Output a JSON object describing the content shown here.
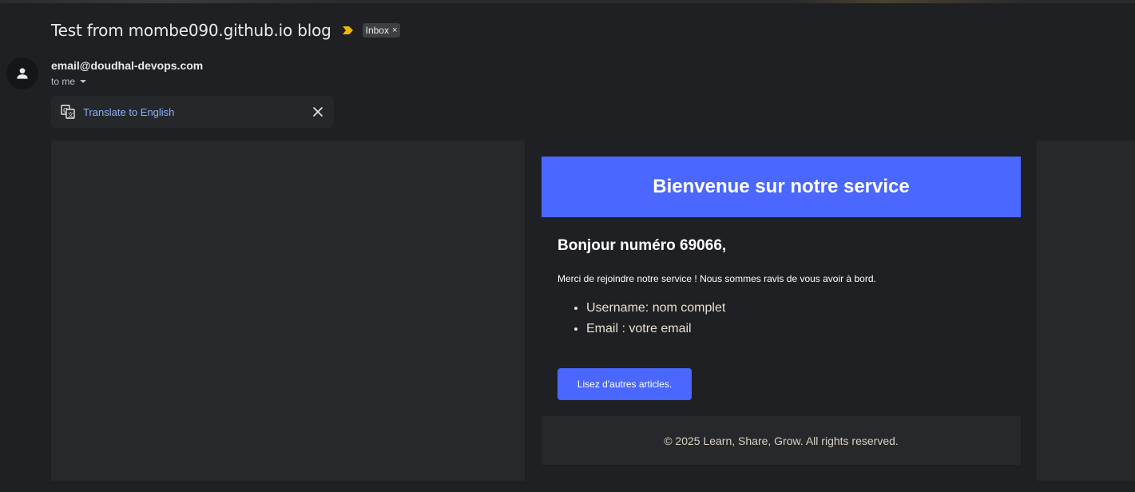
{
  "email": {
    "subject": "Test from mombe090.github.io blog",
    "label": "Inbox",
    "label_remove": "×",
    "sender": "email@doudhal-devops.com",
    "recipient": "to me",
    "translate_link": "Translate to English"
  },
  "content": {
    "header_title": "Bienvenue sur notre service",
    "greeting": "Bonjour numéro 69066,",
    "intro": "Merci de rejoindre notre service ! Nous sommes ravis de vous avoir à bord.",
    "details": [
      "Username: nom complet",
      "Email : votre email"
    ],
    "cta_label": "Lisez d'autres articles.",
    "footer": "© 2025 Learn, Share, Grow. All rights reserved."
  },
  "colors": {
    "brand": "#4a67ff",
    "importance": "#f2b600",
    "link": "#8ab4f8"
  },
  "icons": {
    "importance": "importance-marker-icon",
    "avatar": "person-icon",
    "translate": "translate-icon",
    "close": "close-icon",
    "caret": "caret-down-icon"
  }
}
